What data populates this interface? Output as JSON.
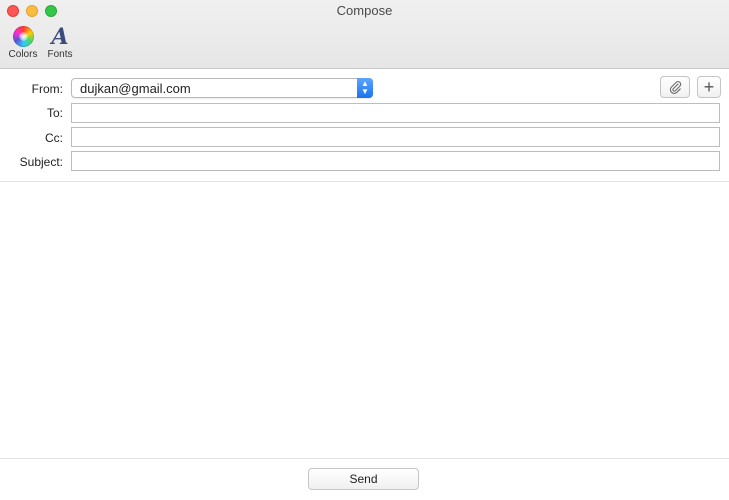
{
  "window": {
    "title": "Compose"
  },
  "toolbar": {
    "colors_label": "Colors",
    "fonts_label": "Fonts",
    "fonts_glyph": "A"
  },
  "header": {
    "from_label": "From:",
    "from_value": "dujkan@gmail.com",
    "to_label": "To:",
    "to_value": "",
    "cc_label": "Cc:",
    "cc_value": "",
    "subject_label": "Subject:",
    "subject_value": "",
    "add_symbol": "+"
  },
  "footer": {
    "send_label": "Send"
  },
  "colors": {
    "accent": "#1a73ec",
    "close": "#fc5753",
    "minimize": "#fdbc40",
    "maximize": "#33c748"
  }
}
